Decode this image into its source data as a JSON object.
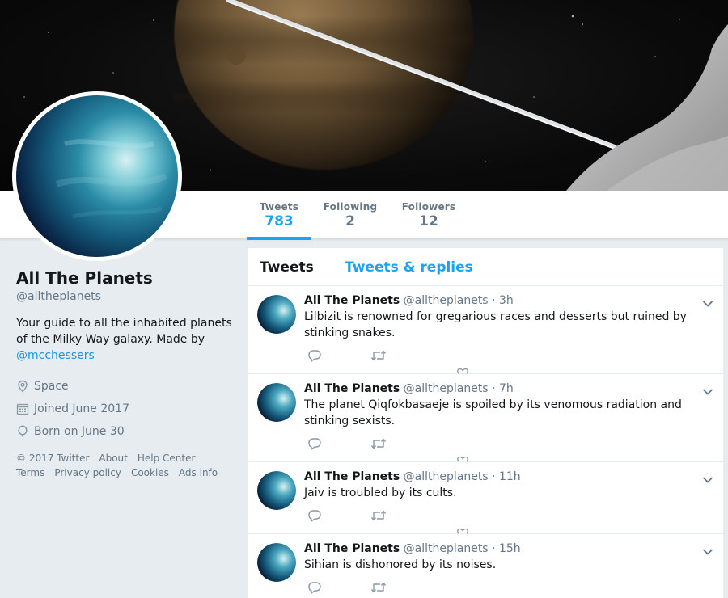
{
  "profile": {
    "name": "All The Planets",
    "handle": "@alltheplanets",
    "bio_text": "Your guide to all the inhabited planets of the Milky Way galaxy. Made by ",
    "bio_link": "@mcchessers",
    "location": "Space",
    "joined": "Joined June 2017",
    "born": "Born on June 30"
  },
  "stats": {
    "tweets_label": "Tweets",
    "tweets_value": "783",
    "following_label": "Following",
    "following_value": "2",
    "followers_label": "Followers",
    "followers_value": "12"
  },
  "footer": {
    "copyright": "© 2017 Twitter",
    "about": "About",
    "help": "Help Center",
    "terms": "Terms",
    "privacy": "Privacy policy",
    "cookies": "Cookies",
    "ads": "Ads info"
  },
  "timeline": {
    "tab_tweets": "Tweets",
    "tab_replies": "Tweets & replies",
    "tweets": [
      {
        "name": "All The Planets",
        "handle": "@alltheplanets",
        "dot": "·",
        "time": "3h",
        "text": "Lilbizit is renowned for gregarious races and desserts but ruined by stinking snakes."
      },
      {
        "name": "All The Planets",
        "handle": "@alltheplanets",
        "dot": "·",
        "time": "7h",
        "text": "The planet Qiqfokbasaeje is spoiled by its venomous radiation and stinking sexists."
      },
      {
        "name": "All The Planets",
        "handle": "@alltheplanets",
        "dot": "·",
        "time": "11h",
        "text": "Jaiv is troubled by its cults."
      },
      {
        "name": "All The Planets",
        "handle": "@alltheplanets",
        "dot": "·",
        "time": "15h",
        "text": "Sihian is dishonored by its noises."
      }
    ]
  },
  "colors": {
    "accent": "#1da1f2",
    "link": "#1b95e0",
    "muted": "#657786",
    "page_bg": "#e6ecf0"
  },
  "icons": [
    "location-icon",
    "calendar-icon",
    "balloon-icon",
    "reply-icon",
    "retweet-icon",
    "like-icon",
    "caret-down-icon"
  ]
}
